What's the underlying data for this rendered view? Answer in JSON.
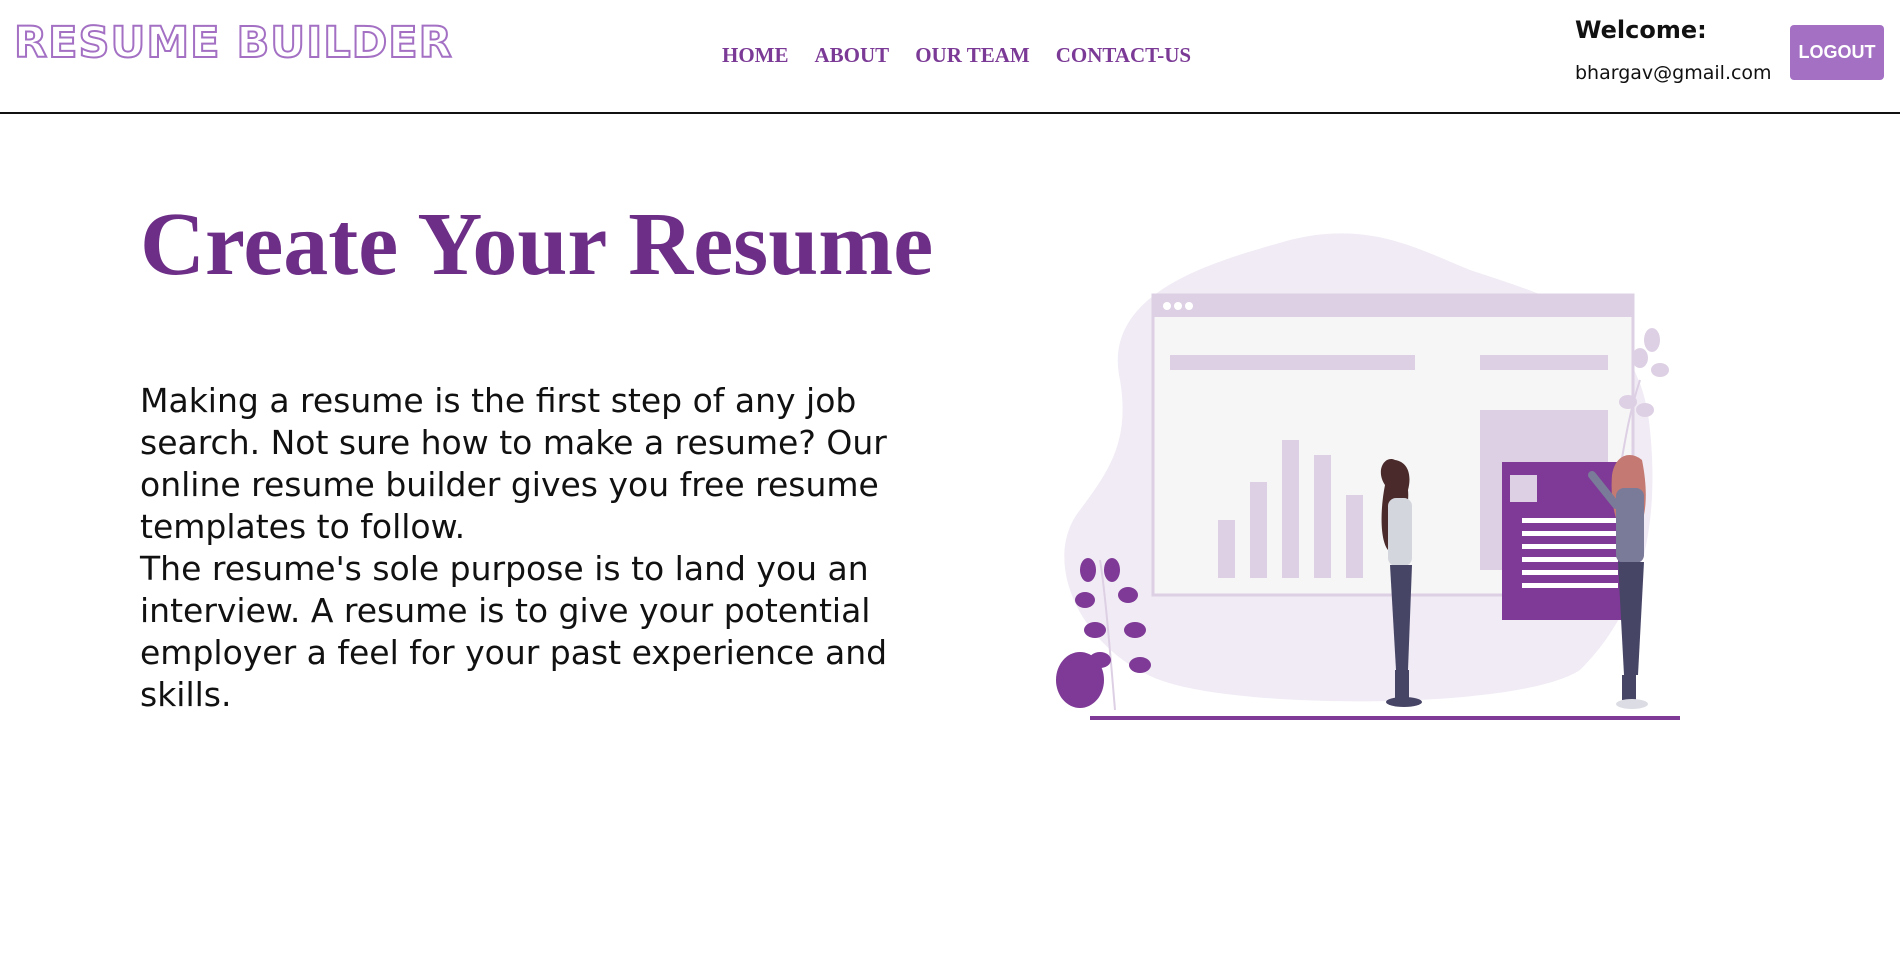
{
  "brand": {
    "logo_text": "RESUME BUILDER"
  },
  "nav": {
    "items": [
      "HOME",
      "ABOUT",
      "OUR TEAM",
      "CONTACT-US"
    ]
  },
  "user": {
    "welcome_label": "Welcome:",
    "email": "bhargav@gmail.com",
    "logout_label": "LOGOUT"
  },
  "hero": {
    "title": "Create Your Resume",
    "paragraph_1": "Making a resume is the first step of any job search. Not sure how to make a resume? Our online resume builder gives you free resume templates to follow.",
    "paragraph_2": "The resume's sole purpose is to land you an interview. A resume is to give your potential employer a feel for your past experience and skills."
  },
  "colors": {
    "accent": "#a370c4",
    "title": "#6d2e87",
    "nav": "#7b3a96",
    "illustration_dark": "#7e3a96",
    "illustration_light": "#ddd0e4",
    "illustration_blob": "#f1ebf5"
  },
  "icons": {
    "illustration": "resume-presentation-illustration"
  }
}
